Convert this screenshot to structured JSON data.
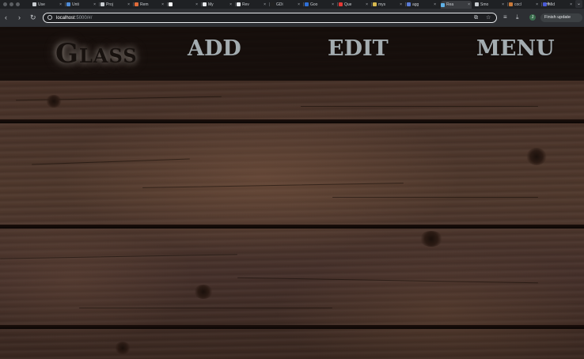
{
  "browser": {
    "tabs": [
      {
        "label": "Use",
        "favicon_color": "#c9cdd1"
      },
      {
        "label": "Unti",
        "favicon_color": "#4f8bd6"
      },
      {
        "label": "Proj",
        "favicon_color": "#c9cdd1"
      },
      {
        "label": "Rem",
        "favicon_color": "#e06b3a"
      },
      {
        "label": "",
        "favicon_color": "#ffffff"
      },
      {
        "label": "My",
        "favicon_color": "#e8eaed"
      },
      {
        "label": "Rev",
        "favicon_color": "#e8eaed"
      },
      {
        "label": "GDi",
        "favicon_color": "#222222"
      },
      {
        "label": "Goo",
        "favicon_color": "#2f6fd6"
      },
      {
        "label": "Que",
        "favicon_color": "#e53935"
      },
      {
        "label": "mys",
        "favicon_color": "#d6b84f"
      },
      {
        "label": "agg",
        "favicon_color": "#5a7bd6"
      },
      {
        "label": "Rea",
        "favicon_color": "#5fb1e6",
        "active": true
      },
      {
        "label": "Smo",
        "favicon_color": "#c9cdd1"
      },
      {
        "label": "cocl",
        "favicon_color": "#c97a3a"
      },
      {
        "label": "Mid",
        "favicon_color": "#4a5bd6"
      }
    ],
    "new_tab_icon": "+",
    "address": {
      "host": "localhost",
      "path": ":5000/#/"
    },
    "update_button": "Finish update",
    "profile_initial": "J"
  },
  "header": {
    "logo": "Glass",
    "nav": [
      {
        "label": "ADD"
      },
      {
        "label": "EDIT"
      },
      {
        "label": "MENU"
      }
    ]
  }
}
